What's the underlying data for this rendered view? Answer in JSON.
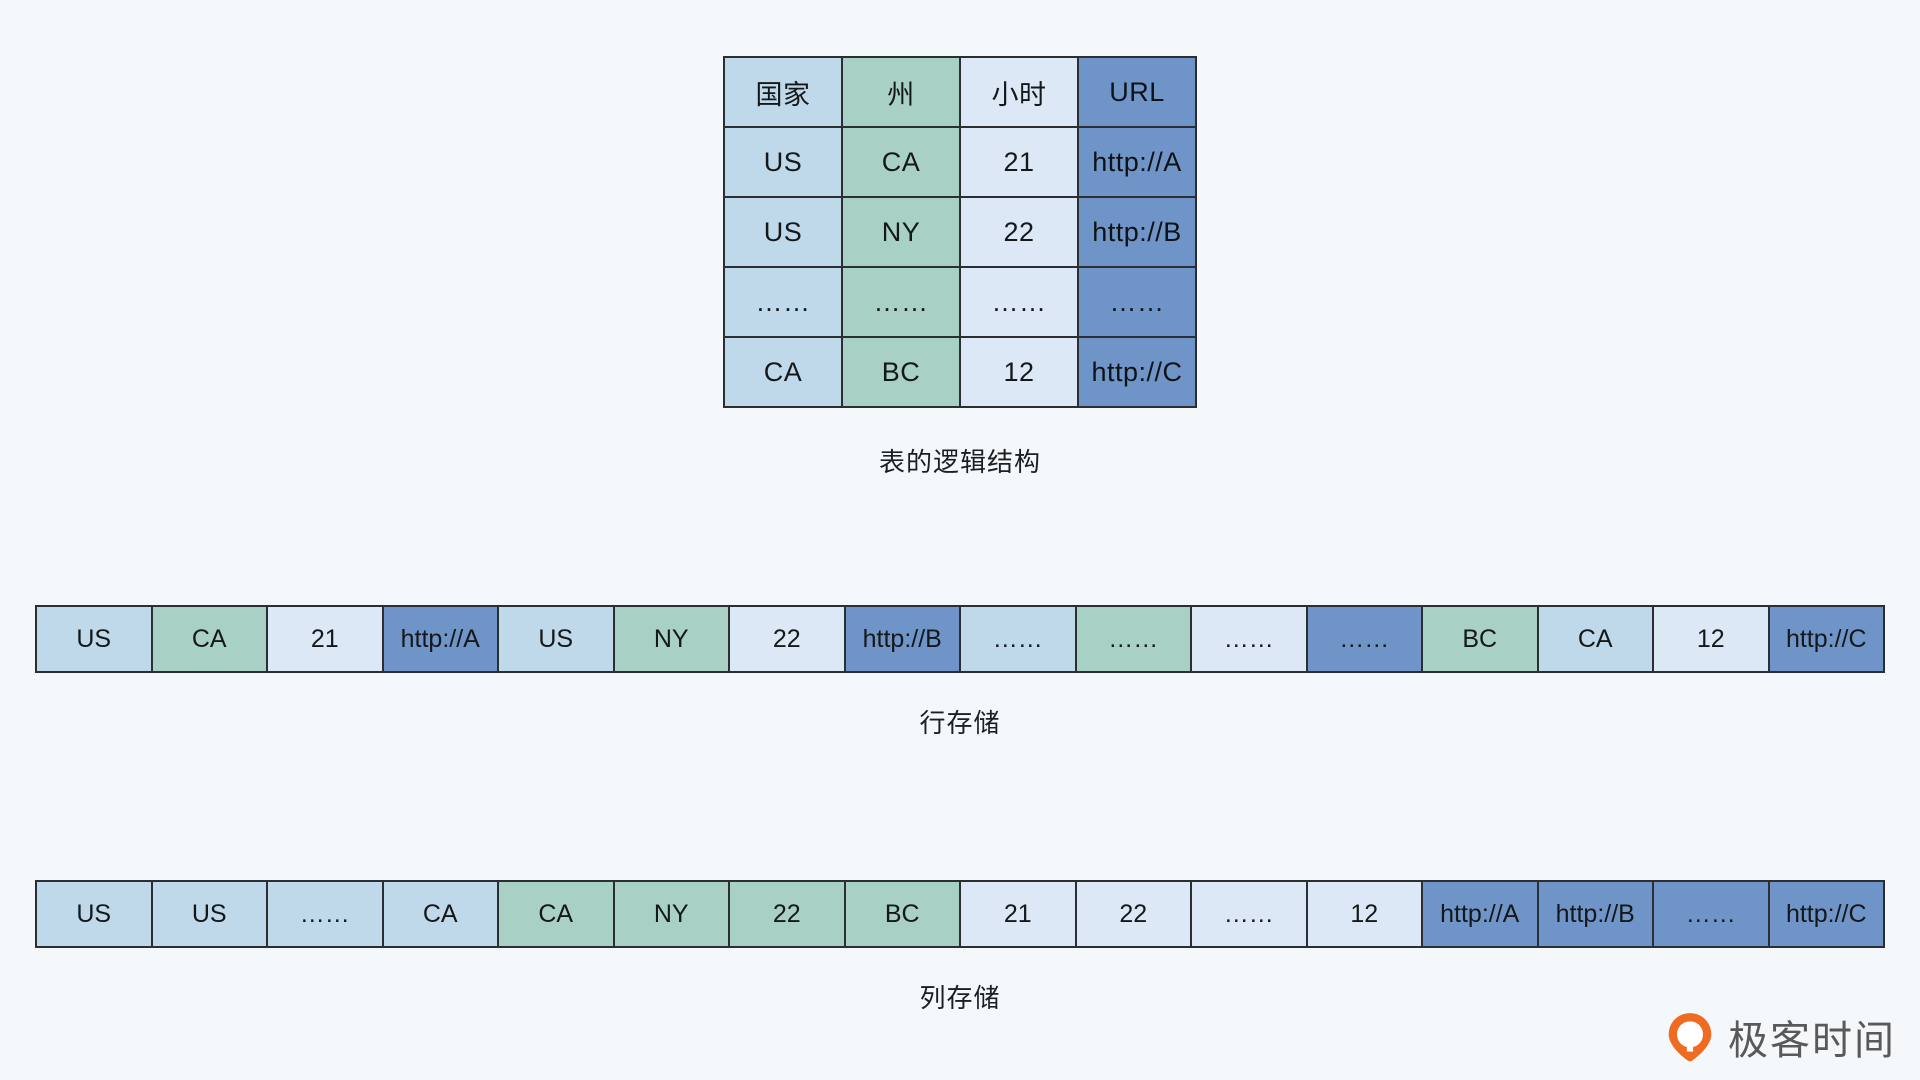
{
  "colors": {
    "background": "#f5f8fa",
    "border": "#2b2f33",
    "country": "#bfd9ea",
    "state": "#a9d0c5",
    "hour": "#dce8f5",
    "url": "#6f95c8",
    "watermark_orange": "#f06b22",
    "watermark_text": "#58595b"
  },
  "logical_table": {
    "caption": "表的逻辑结构",
    "headers": [
      "国家",
      "州",
      "小时",
      "URL"
    ],
    "column_kinds": [
      "country",
      "state",
      "hour",
      "url"
    ],
    "rows": [
      [
        "US",
        "CA",
        "21",
        "http://A"
      ],
      [
        "US",
        "NY",
        "22",
        "http://B"
      ],
      [
        "……",
        "……",
        "……",
        "……"
      ],
      [
        "CA",
        "BC",
        "12",
        "http://C"
      ]
    ]
  },
  "row_storage": {
    "caption": "行存储",
    "cells": [
      {
        "text": "US",
        "kind": "country"
      },
      {
        "text": "CA",
        "kind": "state"
      },
      {
        "text": "21",
        "kind": "hour"
      },
      {
        "text": "http://A",
        "kind": "url"
      },
      {
        "text": "US",
        "kind": "country"
      },
      {
        "text": "NY",
        "kind": "state"
      },
      {
        "text": "22",
        "kind": "hour"
      },
      {
        "text": "http://B",
        "kind": "url"
      },
      {
        "text": "……",
        "kind": "country"
      },
      {
        "text": "……",
        "kind": "state"
      },
      {
        "text": "……",
        "kind": "hour"
      },
      {
        "text": "……",
        "kind": "url"
      },
      {
        "text": "BC",
        "kind": "state"
      },
      {
        "text": "CA",
        "kind": "country"
      },
      {
        "text": "12",
        "kind": "hour"
      },
      {
        "text": "http://C",
        "kind": "url"
      }
    ]
  },
  "column_storage": {
    "caption": "列存储",
    "cells": [
      {
        "text": "US",
        "kind": "country"
      },
      {
        "text": "US",
        "kind": "country"
      },
      {
        "text": "……",
        "kind": "country"
      },
      {
        "text": "CA",
        "kind": "country"
      },
      {
        "text": "CA",
        "kind": "state"
      },
      {
        "text": "NY",
        "kind": "state"
      },
      {
        "text": "22",
        "kind": "state"
      },
      {
        "text": "BC",
        "kind": "state"
      },
      {
        "text": "21",
        "kind": "hour"
      },
      {
        "text": "22",
        "kind": "hour"
      },
      {
        "text": "……",
        "kind": "hour"
      },
      {
        "text": "12",
        "kind": "hour"
      },
      {
        "text": "http://A",
        "kind": "url"
      },
      {
        "text": "http://B",
        "kind": "url"
      },
      {
        "text": "……",
        "kind": "url"
      },
      {
        "text": "http://C",
        "kind": "url"
      }
    ]
  },
  "watermark": {
    "text": "极客时间",
    "logo_name": "geektime-logo-icon"
  }
}
